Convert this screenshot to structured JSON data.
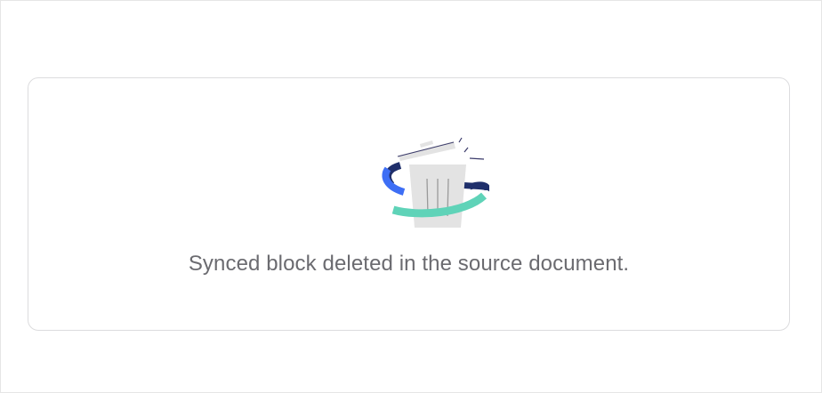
{
  "placeholder": {
    "message": "Synced block deleted in the source document.",
    "illustration_icon": "trash-with-sync-arrows-icon"
  },
  "colors": {
    "text": "#6b6b70",
    "card_border": "#dcdcde",
    "arc_blue": "#3d6ef5",
    "arc_navy": "#1f2f6b",
    "arc_teal": "#5fd3b8",
    "bin_gray": "#e3e3e3"
  }
}
